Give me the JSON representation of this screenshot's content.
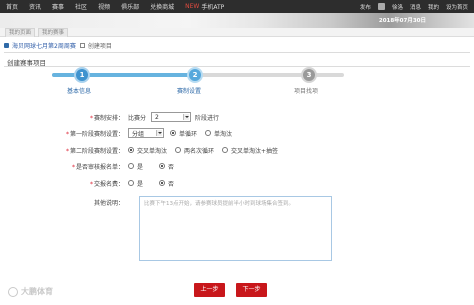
{
  "topnav": {
    "items": [
      "首页",
      "资讯",
      "赛事",
      "社区",
      "视频",
      "俱乐部",
      "兑换商城"
    ],
    "new_badge": "NEW",
    "atp": "手机ATP",
    "right": [
      "发布",
      "徐洛",
      "消息",
      "我的",
      "设为首页"
    ]
  },
  "banner": {
    "date": "2018年07月30日"
  },
  "tabs": [
    "我的页面",
    "我的赛事"
  ],
  "breadcrumb": {
    "link": "海贝网球七月第2周周赛",
    "current": "创建项目"
  },
  "section_title": "创建赛事项目",
  "steps": [
    {
      "num": "1",
      "label": "基本信息"
    },
    {
      "num": "2",
      "label": "赛制设置"
    },
    {
      "num": "3",
      "label": "项目找项"
    }
  ],
  "form": {
    "stage": {
      "label": "赛制安排：",
      "prefix": "比赛分",
      "value": "2",
      "suffix": "阶段进行"
    },
    "stage1": {
      "label": "第一阶段赛制设置：",
      "select": "分组",
      "options": [
        "单循环",
        "单淘汰"
      ],
      "selected": 0
    },
    "stage2": {
      "label": "第二阶段赛制设置：",
      "options": [
        "交叉单淘汰",
        "两名次循环",
        "交叉单淘汰+抽签"
      ],
      "selected": 0
    },
    "review": {
      "label": "是否审核报名单：",
      "options": [
        "是",
        "否"
      ],
      "selected": 1
    },
    "fee": {
      "label": "交报名费：",
      "options": [
        "是",
        "否"
      ],
      "selected": 1
    },
    "notes": {
      "label": "其他说明：",
      "placeholder": "比赛下午13点开始，请参赛球员提前半小时到球场集合签到。"
    }
  },
  "buttons": {
    "prev": "上一步",
    "next": "下一步"
  },
  "watermark": "大鹏体育",
  "colors": {
    "accent": "#3f93cf",
    "button": "#c8171b",
    "link": "#2f5da8"
  }
}
